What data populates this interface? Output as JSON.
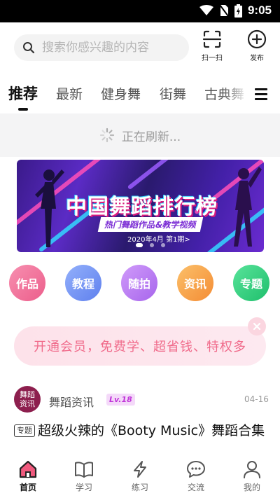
{
  "status_bar": {
    "time": "9:05"
  },
  "search": {
    "placeholder": "搜索你感兴趣的内容"
  },
  "header": {
    "scan_label": "扫一扫",
    "publish_label": "发布"
  },
  "tabs": [
    {
      "label": "推荐",
      "active": true
    },
    {
      "label": "最新"
    },
    {
      "label": "健身舞"
    },
    {
      "label": "街舞"
    },
    {
      "label": "古典舞"
    }
  ],
  "refresh": {
    "text": "正在刷新..."
  },
  "banner": {
    "title": "中国舞蹈排行榜",
    "subtitle": "热门舞蹈作品&教学视频",
    "date": "2020年4月 第1期>",
    "current_slide": 1,
    "total_slides": 3
  },
  "categories": [
    {
      "label": "作品",
      "color": "#f06d97"
    },
    {
      "label": "教程",
      "color": "#6b8ff2"
    },
    {
      "label": "随拍",
      "color": "#b77bf0"
    },
    {
      "label": "资讯",
      "color": "#f7a24c"
    },
    {
      "label": "专题",
      "color": "#2ecf7a"
    }
  ],
  "vip": {
    "text": "开通会员，免费学、超省钱、特权多"
  },
  "post": {
    "avatar_text": "舞蹈资讯",
    "author": "舞蹈资讯",
    "level": "Lv.18",
    "date": "04-16",
    "tag": "专题",
    "title": "超级火辣的《Booty Music》舞蹈合集"
  },
  "bottom_nav": [
    {
      "label": "首页",
      "icon": "home-icon",
      "active": true
    },
    {
      "label": "学习",
      "icon": "book-icon"
    },
    {
      "label": "练习",
      "icon": "lightning-icon"
    },
    {
      "label": "交流",
      "icon": "chat-icon"
    },
    {
      "label": "我的",
      "icon": "profile-icon"
    }
  ],
  "colors": {
    "accent_pink": "#f06a8a",
    "active_nav": "#f05a7e"
  }
}
